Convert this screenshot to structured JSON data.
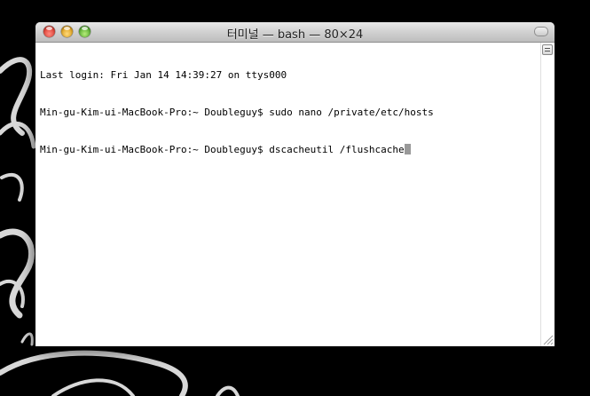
{
  "window": {
    "title": "터미널 — bash — 80×24"
  },
  "terminal": {
    "lines": [
      "Last login: Fri Jan 14 14:39:27 on ttys000",
      "Min-gu-Kim-ui-MacBook-Pro:~ Doubleguy$ sudo nano /private/etc/hosts",
      "Min-gu-Kim-ui-MacBook-Pro:~ Doubleguy$ dscacheutil /flushcache"
    ]
  },
  "colors": {
    "desktop_background": "#000000",
    "terminal_background": "#ffffff",
    "terminal_text": "#000000",
    "cursor": "#999999",
    "close_button": "#d9382c",
    "minimize_button": "#d99a15",
    "zoom_button": "#4ea52a"
  },
  "icons": {
    "close": "close-icon",
    "minimize": "minimize-icon",
    "zoom": "zoom-icon",
    "toolbar_toggle": "toolbar-toggle-icon",
    "split": "split-pane-icon",
    "resize": "resize-grip-icon"
  }
}
